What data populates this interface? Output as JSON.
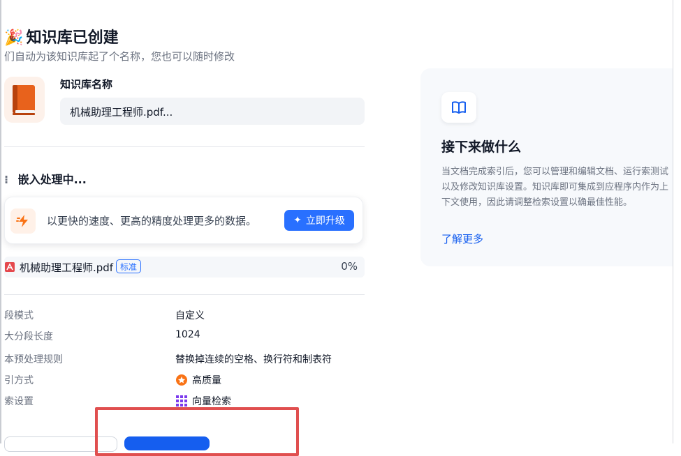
{
  "header": {
    "emoji": "🎉",
    "title": "知识库已创建",
    "subtitle": "们自动为该知识库起了个名称，您也可以随时修改"
  },
  "kb_name": {
    "label": "知识库名称",
    "value": "机械助理工程师.pdf...",
    "icon": "book-icon"
  },
  "embedding": {
    "title": "嵌入处理中...",
    "upgrade_text": "以更快的速度、更高的精度处理更多的数据。",
    "upgrade_button": "立即升级",
    "file": {
      "name": "机械助理工程师.pdf",
      "badge": "标准",
      "progress": "0%"
    }
  },
  "settings": [
    {
      "label": "段模式",
      "value": "自定义"
    },
    {
      "label": "大分段长度",
      "value": "1024"
    },
    {
      "label": "本预处理规则",
      "value": "替换掉连续的空格、换行符和制表符"
    },
    {
      "label": "引方式",
      "value": "高质量"
    },
    {
      "label": "索设置",
      "value": "向量检索"
    }
  ],
  "next_steps": {
    "title": "接下来做什么",
    "description": "当文档完成索引后，您可以管理和编辑文档、运行索测试以及修改知识库设置。知识库即可集成到应程序内作为上下文使用，因此请调整检索设置以确最佳性能。",
    "link": "了解更多"
  },
  "colors": {
    "primary": "#155eef",
    "highlight": "#e04f4f",
    "accent_orange": "#f97316"
  }
}
